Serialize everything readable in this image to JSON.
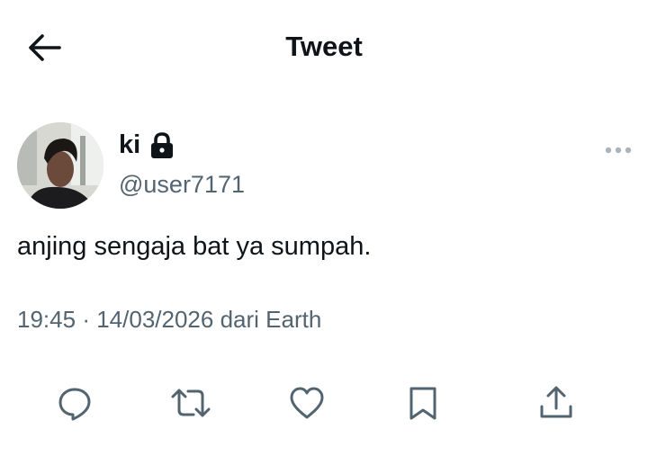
{
  "header": {
    "title": "Tweet"
  },
  "icons": {
    "back": "arrow-left-icon",
    "lock": "lock-icon",
    "more": "more-horizontal-icon",
    "reply": "reply-icon",
    "retweet": "retweet-icon",
    "like": "heart-icon",
    "bookmark": "bookmark-icon",
    "share": "share-icon"
  },
  "author": {
    "display_name": "ki",
    "handle": "@user7171",
    "protected": true
  },
  "tweet": {
    "text": "anjing sengaja bat ya sumpah.",
    "time": "19:45",
    "separator": "·",
    "date": "14/03/2026",
    "source_label": "dari Earth"
  },
  "colors": {
    "text_primary": "#0f1419",
    "text_secondary": "#536471",
    "icon": "#536471",
    "background": "#ffffff"
  }
}
